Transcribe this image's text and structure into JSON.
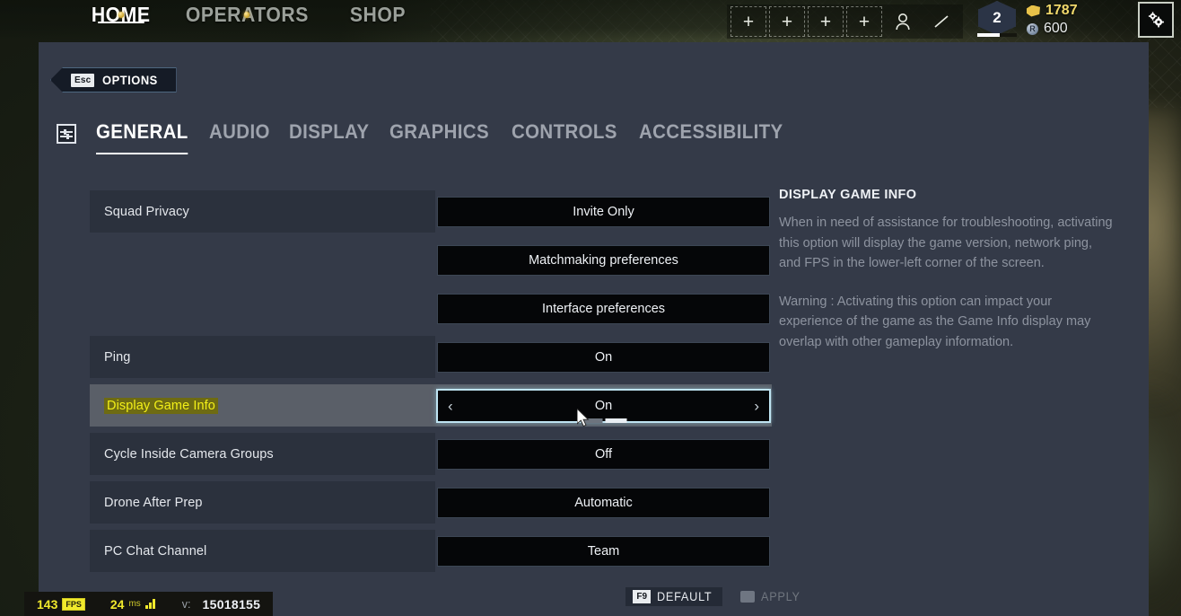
{
  "topbar": {
    "nav": [
      {
        "label": "HOME",
        "active": true,
        "dot": true
      },
      {
        "label": "OPERATORS",
        "active": false,
        "dot": true
      },
      {
        "label": "SHOP",
        "active": false,
        "dot": false
      }
    ],
    "slots": [
      {
        "icon": "plus-icon",
        "label": "+"
      },
      {
        "icon": "plus-icon",
        "label": "+"
      },
      {
        "icon": "plus-icon",
        "label": "+"
      },
      {
        "icon": "plus-icon",
        "label": "+"
      },
      {
        "icon": "person-icon",
        "label": ""
      },
      {
        "icon": "slash-icon",
        "label": ""
      }
    ],
    "level": "2",
    "renown": "1787",
    "credits": "600",
    "credit_glyph": "R",
    "settings_icon": "gears-icon"
  },
  "options": {
    "esc_key": "Esc",
    "esc_label": "OPTIONS",
    "category_icon": "sliders-icon",
    "tabs": [
      {
        "label": "GENERAL",
        "active": true
      },
      {
        "label": "AUDIO",
        "active": false
      },
      {
        "label": "DISPLAY",
        "active": false
      },
      {
        "label": "GRAPHICS",
        "active": false
      },
      {
        "label": "CONTROLS",
        "active": false
      },
      {
        "label": "ACCESSIBILITY",
        "active": false
      }
    ],
    "rows": [
      {
        "label": "Squad Privacy",
        "value": "Invite Only",
        "selected": false,
        "blank": false
      },
      {
        "label": "",
        "value": "Matchmaking preferences",
        "selected": false,
        "blank": true
      },
      {
        "label": "",
        "value": "Interface preferences",
        "selected": false,
        "blank": true
      },
      {
        "label": "Ping",
        "value": "On",
        "selected": false,
        "blank": false
      },
      {
        "label": "Display Game Info",
        "value": "On",
        "selected": true,
        "blank": false
      },
      {
        "label": "Cycle Inside Camera Groups",
        "value": "Off",
        "selected": false,
        "blank": false
      },
      {
        "label": "Drone After Prep",
        "value": "Automatic",
        "selected": false,
        "blank": false
      },
      {
        "label": "PC Chat Channel",
        "value": "Team",
        "selected": false,
        "blank": false
      }
    ],
    "selector": {
      "prev_glyph": "‹",
      "next_glyph": "›",
      "segments": 2,
      "active_segment": 2
    },
    "info": {
      "title": "DISPLAY GAME INFO",
      "paragraphs": [
        "When in need of assistance for troubleshooting, activating this option will display the game version, network ping, and FPS in the lower-left corner of the screen.",
        "Warning : Activating this option can impact your experience of the game as the Game Info display may overlap with other gameplay information."
      ]
    },
    "actions": {
      "default_key": "F9",
      "default_label": "DEFAULT",
      "apply_label": "APPLY",
      "apply_enabled": false
    }
  },
  "game_info": {
    "fps_value": "143",
    "fps_unit": "FPS",
    "ping_value": "24",
    "ping_unit": "ms",
    "version_label": "v:",
    "version_value": "15018155"
  }
}
